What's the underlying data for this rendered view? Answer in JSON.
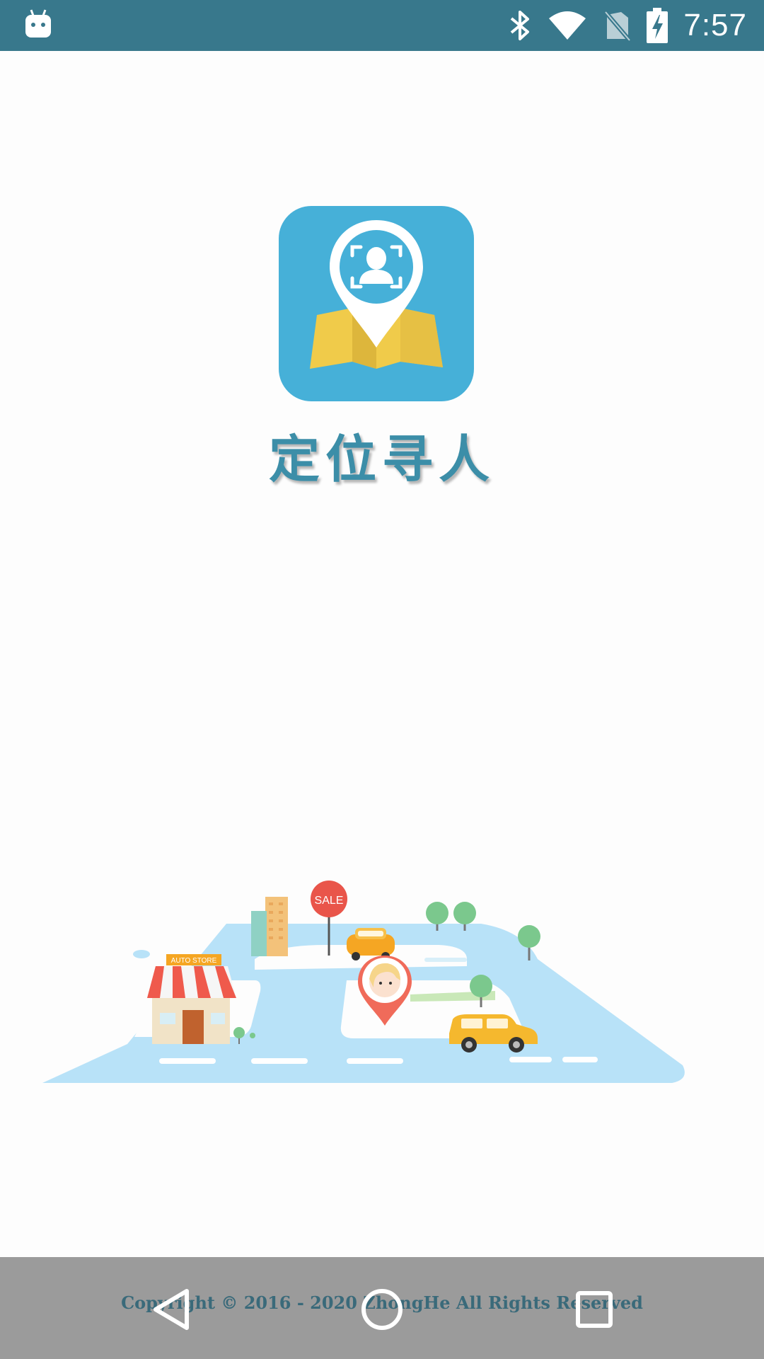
{
  "status_bar": {
    "time": "7:57",
    "icons": [
      "android-notification-icon",
      "bluetooth-icon",
      "wifi-icon",
      "no-sim-icon",
      "battery-charging-icon"
    ]
  },
  "splash": {
    "logo_icon": "location-pin-map-icon",
    "app_name": "定位寻人",
    "illustration": {
      "store_sign": "AUTO STORE",
      "sale_sign": "SALE"
    }
  },
  "footer": {
    "copyright": "Copyright © 2016 - 2020 ZhongHe All Rights Reserved"
  },
  "nav_bar": {
    "buttons": [
      "back-icon",
      "home-icon",
      "recents-icon"
    ]
  },
  "colors": {
    "status_bar": "#38788c",
    "logo_bg": "#46b0d8",
    "map_yellow": "#f0cb4a",
    "app_name": "#3c8ea8",
    "nav_bar": "#9b9b9b",
    "road": "#b8e2f8"
  }
}
